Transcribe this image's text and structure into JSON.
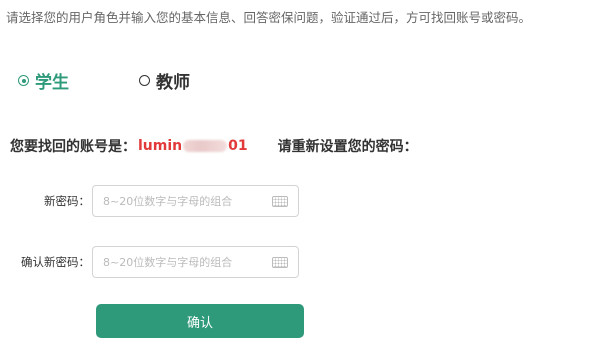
{
  "instructions": "请选择您的用户角色并输入您的基本信息、回答密保问题，验证通过后，方可找回账号或密码。",
  "roles": [
    {
      "label": "学生",
      "selected": true
    },
    {
      "label": "教师",
      "selected": false
    }
  ],
  "account": {
    "label": "您要找回的账号是：",
    "value_prefix": "lumin",
    "value_suffix": "01",
    "reset_prompt": "请重新设置您的密码："
  },
  "form": {
    "new_password_label": "新密码：",
    "new_password_placeholder": "8~20位数字与字母的组合",
    "confirm_password_label": "确认新密码：",
    "confirm_password_placeholder": "8~20位数字与字母的组合",
    "keyboard_icon": "keyboard-icon"
  },
  "submit_label": "确认",
  "colors": {
    "accent": "#2e9a7a",
    "account_highlight": "#e23a3a"
  }
}
